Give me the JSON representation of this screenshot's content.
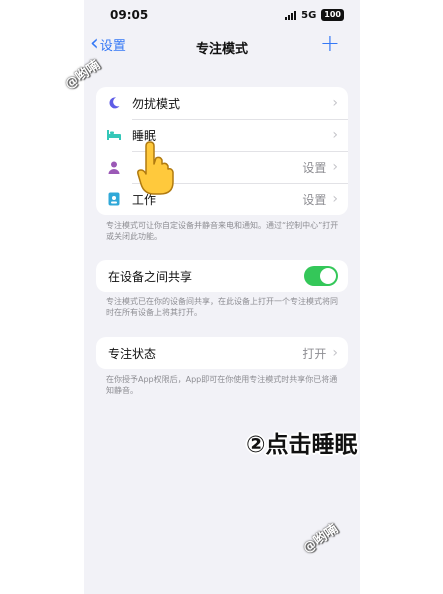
{
  "status_bar": {
    "time": "09:05",
    "network": "5G",
    "battery": "100"
  },
  "nav": {
    "back_label": "设置",
    "title": "专注模式",
    "add_symbol": "+"
  },
  "focus_modes": [
    {
      "label": "勿扰模式",
      "value": "",
      "icon": "moon-icon"
    },
    {
      "label": "睡眠",
      "value": "",
      "icon": "bed-icon"
    },
    {
      "label": "",
      "value": "设置",
      "icon": "person-icon"
    },
    {
      "label": "工作",
      "value": "设置",
      "icon": "badge-icon"
    }
  ],
  "focus_modes_footnote": "专注模式可让你自定设备并静音来电和通知。通过“控制中心”打开或关闭此功能。",
  "share": {
    "label": "在设备之间共享",
    "enabled": true,
    "footnote": "专注模式已在你的设备间共享，在此设备上打开一个专注模式将同时在所有设备上将其打开。"
  },
  "focus_status": {
    "label": "专注状态",
    "value": "打开",
    "footnote": "在你授予App权限后，App即可在你使用专注模式时共享你已将通知静音。"
  },
  "watermark": "@哟喃",
  "annotation": "②点击睡眠",
  "colors": {
    "accent": "#3478f6",
    "toggle_on": "#34c759",
    "moon": "#5e5ce6",
    "bed": "#34c7b8",
    "person": "#9b59b6",
    "badge": "#30a8d8"
  }
}
